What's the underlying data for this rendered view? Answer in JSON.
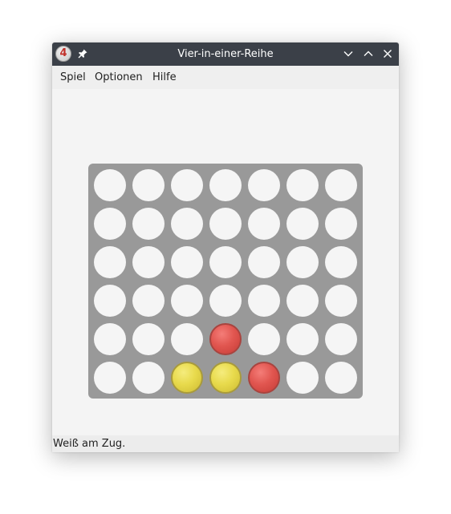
{
  "window": {
    "title": "Vier-in-einer-Reihe",
    "icon_label": "4"
  },
  "menu": {
    "items": [
      "Spiel",
      "Optionen",
      "Hilfe"
    ]
  },
  "board": {
    "rows": 6,
    "cols": 7,
    "colors": {
      "board": "#999999",
      "empty": "#f5f5f5",
      "red": "#e15650",
      "yellow": "#e8da4c"
    },
    "cells": [
      [
        "empty",
        "empty",
        "empty",
        "empty",
        "empty",
        "empty",
        "empty"
      ],
      [
        "empty",
        "empty",
        "empty",
        "empty",
        "empty",
        "empty",
        "empty"
      ],
      [
        "empty",
        "empty",
        "empty",
        "empty",
        "empty",
        "empty",
        "empty"
      ],
      [
        "empty",
        "empty",
        "empty",
        "empty",
        "empty",
        "empty",
        "empty"
      ],
      [
        "empty",
        "empty",
        "empty",
        "red",
        "empty",
        "empty",
        "empty"
      ],
      [
        "empty",
        "empty",
        "yellow",
        "yellow",
        "red",
        "empty",
        "empty"
      ]
    ]
  },
  "status": {
    "text": "Weiß am Zug."
  },
  "icons": {
    "app": "connect-four-icon",
    "pin": "pin-icon",
    "minimize": "chevron-down-icon",
    "maximize": "chevron-up-icon",
    "close": "close-icon"
  }
}
